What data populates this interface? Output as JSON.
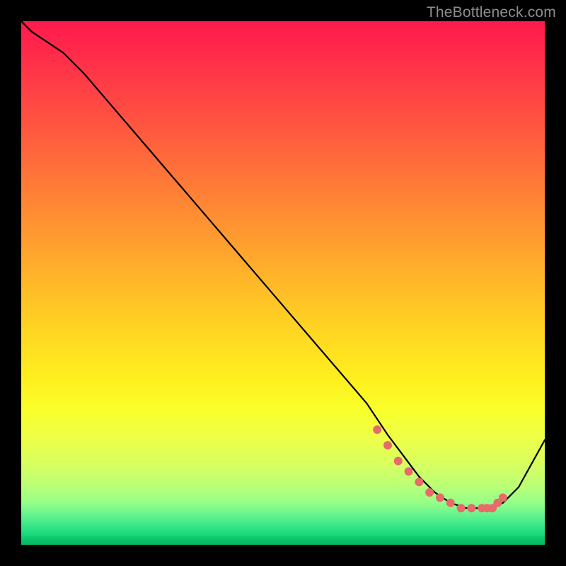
{
  "watermark": {
    "text": "TheBottleneck.com"
  },
  "chart_data": {
    "type": "line",
    "title": "",
    "xlabel": "",
    "ylabel": "",
    "xlim": [
      0,
      100
    ],
    "ylim": [
      0,
      100
    ],
    "grid": false,
    "curve": {
      "x": [
        0,
        2,
        5,
        8,
        12,
        18,
        24,
        30,
        36,
        42,
        48,
        54,
        60,
        66,
        70,
        73,
        76,
        79,
        82,
        85,
        88,
        90,
        92,
        95,
        100
      ],
      "y": [
        100,
        98,
        96,
        94,
        90,
        83,
        76,
        69,
        62,
        55,
        48,
        41,
        34,
        27,
        21,
        17,
        13,
        10,
        8,
        7,
        7,
        7,
        8,
        11,
        20
      ]
    },
    "marker": {
      "color": "#e86a6a",
      "points_x": [
        68,
        70,
        72,
        74,
        76,
        78,
        80,
        82,
        84,
        86,
        88,
        89,
        90,
        91,
        92
      ],
      "points_y": [
        22,
        19,
        16,
        14,
        12,
        10,
        9,
        8,
        7,
        7,
        7,
        7,
        7,
        8,
        9
      ]
    }
  }
}
